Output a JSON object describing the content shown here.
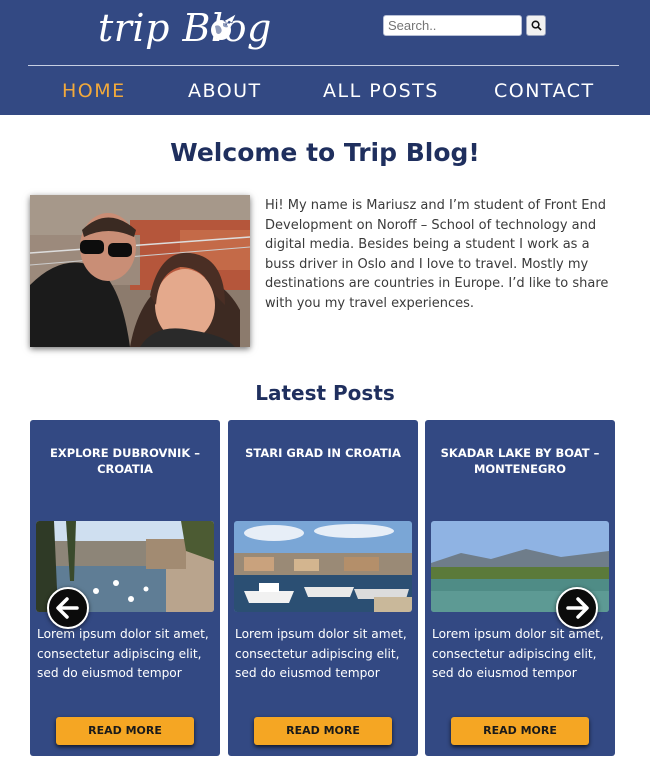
{
  "header": {
    "logo_text": "trip Blog",
    "logo_icon": "globe-plane-icon",
    "search": {
      "placeholder": "Search..",
      "value": "",
      "button_icon": "search-icon"
    },
    "colors": {
      "background": "#334983",
      "active_nav": "#f2a93b"
    }
  },
  "nav": {
    "items": [
      {
        "label": "HOME",
        "active": true
      },
      {
        "label": "ABOUT",
        "active": false
      },
      {
        "label": "ALL POSTS",
        "active": false
      },
      {
        "label": "CONTACT",
        "active": false
      }
    ]
  },
  "main": {
    "title": "Welcome to Trip Blog!",
    "intro": "Hi! My name is Mariusz and I’m student of Front End Development on Noroff – School of technology and digital media. Besides being a student I work as a buss driver in Oslo and I love to travel. Mostly my destinations are countries in Europe. I’d like to share with you my travel experiences.",
    "latest_heading": "Latest Posts"
  },
  "posts": [
    {
      "title": "EXPLORE DUBROVNIK – CROATIA",
      "excerpt": "Lorem ipsum dolor sit amet, consectetur adipiscing elit, sed do eiusmod tempor",
      "button": "READ MORE"
    },
    {
      "title": "STARI GRAD IN CROATIA",
      "excerpt": "Lorem ipsum dolor sit amet, consectetur adipiscing elit, sed do eiusmod tempor",
      "button": "READ MORE"
    },
    {
      "title": "SKADAR LAKE BY BOAT – MONTENEGRO",
      "excerpt": "Lorem ipsum dolor sit amet, consectetur adipiscing elit, sed do eiusmod tempor",
      "button": "READ MORE"
    }
  ],
  "carousel": {
    "prev_icon": "arrow-left-icon",
    "next_icon": "arrow-right-icon"
  },
  "accent": "#f5a623"
}
